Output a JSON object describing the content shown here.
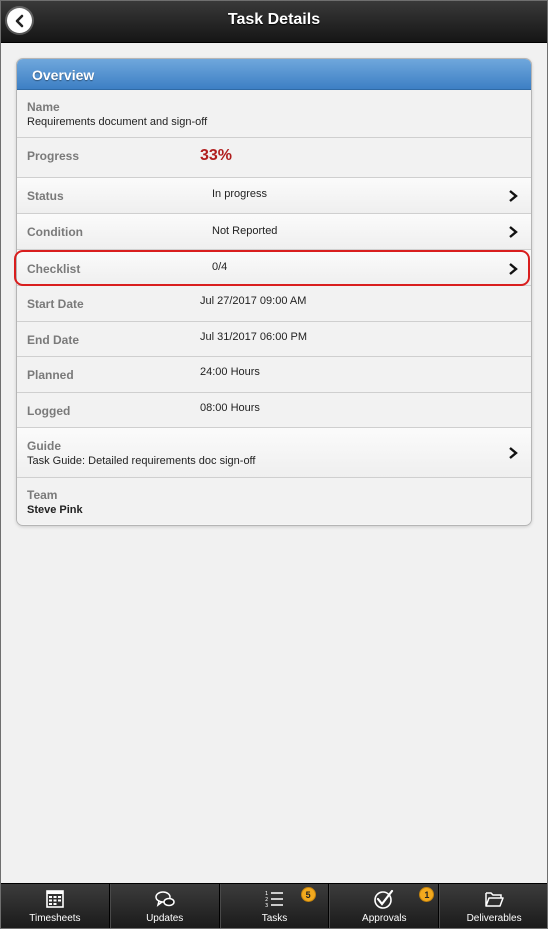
{
  "header": {
    "title": "Task Details"
  },
  "overview": {
    "title": "Overview",
    "name_label": "Name",
    "name_value": "Requirements document and sign-off",
    "progress_label": "Progress",
    "progress_value": "33%",
    "status_label": "Status",
    "status_value": "In progress",
    "condition_label": "Condition",
    "condition_value": "Not Reported",
    "checklist_label": "Checklist",
    "checklist_value": "0/4",
    "start_label": "Start Date",
    "start_value": "Jul 27/2017 09:00 AM",
    "end_label": "End Date",
    "end_value": "Jul 31/2017 06:00 PM",
    "planned_label": "Planned",
    "planned_value": "24:00 Hours",
    "logged_label": "Logged",
    "logged_value": "08:00 Hours",
    "guide_label": "Guide",
    "guide_value": "Task Guide: Detailed requirements doc sign-off",
    "team_label": "Team",
    "team_value": "Steve Pink"
  },
  "colors": {
    "accent": "#4a8bcf",
    "progress": "#b01e1e",
    "highlight": "#d91e1e",
    "badge": "#f2a91e"
  },
  "nav": {
    "items": [
      {
        "label": "Timesheets",
        "icon": "calendar-icon"
      },
      {
        "label": "Updates",
        "icon": "chat-bubbles-icon"
      },
      {
        "label": "Tasks",
        "icon": "list-icon",
        "badge": "5"
      },
      {
        "label": "Approvals",
        "icon": "check-circle-icon",
        "badge": "1"
      },
      {
        "label": "Deliverables",
        "icon": "folder-icon"
      }
    ]
  }
}
